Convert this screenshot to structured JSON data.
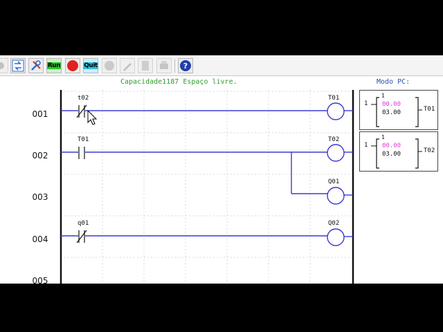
{
  "toolbar": {
    "run_label": "Run",
    "stop_label": "Stop",
    "quit_label": "Quit"
  },
  "status": {
    "capacity_label": "Capacidade",
    "capacity_value": "1187",
    "free_space_label": "Espaço livre.",
    "mode_label": "Modo PC:"
  },
  "rungs": [
    {
      "number": "001",
      "contact_label": "t02",
      "contact_type": "normally-closed",
      "coil_label": "T01"
    },
    {
      "number": "002",
      "contact_label": "T01",
      "contact_type": "normally-open",
      "coil_label": "T02"
    },
    {
      "number": "003",
      "contact_label": "",
      "contact_type": "",
      "coil_label": "Q01"
    },
    {
      "number": "004",
      "contact_label": "q01",
      "contact_type": "normally-closed",
      "coil_label": "Q02"
    },
    {
      "number": "005",
      "contact_label": "",
      "contact_type": "",
      "coil_label": ""
    }
  ],
  "timers": [
    {
      "index": "1",
      "small_value": "1",
      "current_value": "00.00",
      "preset_value": "03.00",
      "name": "T01"
    },
    {
      "index": "1",
      "small_value": "1",
      "current_value": "00.00",
      "preset_value": "03.00",
      "name": "T02"
    }
  ],
  "colors": {
    "wire": "#3a3ad0",
    "rail": "#111111",
    "capacity_text": "#2f9a2f",
    "mode_text": "#2a4fa8",
    "timer_value": "#e23ad8",
    "run_button": "#2fc42f",
    "stop_button": "#e02020",
    "quit_button": "#30c0e0"
  }
}
